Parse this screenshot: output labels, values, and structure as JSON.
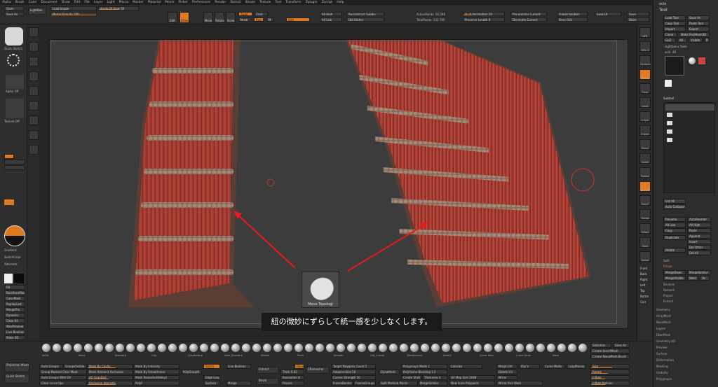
{
  "menu": [
    "Alpha",
    "Brush",
    "Color",
    "Document",
    "Draw",
    "Edit",
    "File",
    "Layer",
    "Light",
    "Macro",
    "Marker",
    "Material",
    "Movie",
    "Picker",
    "Preferences",
    "Render",
    "Stencil",
    "Stroke",
    "Texture",
    "Tool",
    "Transform",
    "Zplugin",
    "Zscript",
    "Help"
  ],
  "top": {
    "open": "Open",
    "save_as": "Save As",
    "lightbox": "LightBox",
    "load_image": "Load Image",
    "model_opacity": "Model Opacity 100",
    "angle_of_view": "Angle Of View 50",
    "edit": "Edit",
    "draw": "Draw",
    "move": "Move",
    "rotate": "Rotate",
    "scale": "Scale",
    "zadd": "Zadd",
    "zsub": "Zsub",
    "mrgb": "Mrgb",
    "rgb": "Rgb",
    "m": "M",
    "size": "Size",
    "all_high": "All High",
    "all_low": "All Low",
    "reconstruct_subdiv": "Reconstruct Subdiv",
    "del_higher": "Del Higher",
    "active_points": "ActivePoints: 56,596",
    "total_points": "TotalPoints: 132.795",
    "pct_decimation": "% of decimation 20",
    "preserve_length": "Preserve Length 0",
    "preprocess": "Pre-process Current",
    "decimate": "Decimate Current",
    "freeze_borders": "Freeze borders",
    "keep_uvs": "Keep UVs",
    "save_ui": "Save UI",
    "save": "Save",
    "store": "Store"
  },
  "left": {
    "quick_sketch": "Quick Sketch",
    "alpha_off": "Alpha Off",
    "texture_off": "Texture Off",
    "gradient": "Gradient",
    "switch_color": "SwitchColor",
    "alternate": "Alternate",
    "fill": "Fill",
    "backface_mask": "BackfaceMask",
    "color_mask": "ColorMask",
    "replay_last": "ReplayLast",
    "merge_tris": "MergeTris",
    "dynamic": "Dynamic",
    "clear_all": "Clear All",
    "wax_preview": "WaxPreview",
    "live_boolean": "Live Boolean",
    "make_3d": "Make 3D",
    "mrgb": "MRGB",
    "rgb": "RGB",
    "m": "M"
  },
  "tools": [
    "Move",
    "Standard",
    "Clay",
    "ClayBuildup",
    "Dam_Standard",
    "Inflat",
    "Pinch",
    "Polish",
    "Smooth"
  ],
  "right_bar": [
    "BPR",
    "SPix 3",
    "Dynamic",
    "Persp",
    "Floor",
    "Local",
    "L.Sym",
    "Frame",
    "Move",
    "Scale",
    "Rotate",
    "Line Fill",
    "PolyF",
    "Transp",
    "Ghost",
    "Solo",
    "Xpose"
  ],
  "right_bar_bottom": [
    "Front",
    "Back",
    "Right",
    "Left",
    "Top",
    "Bottm",
    "Curr"
  ],
  "panel": {
    "title": "Tool",
    "brand": "ochi",
    "load_tool": "Load Tool",
    "save_as": "Save As",
    "copy_tool": "Copy Tool",
    "paste_tool": "Paste Tool",
    "import": "Import",
    "export": "Export",
    "clone": "Clone",
    "make_polymesh": "Make PolyMesh3D",
    "goz": "GoZ",
    "all": "All",
    "visible": "Visible",
    "r": "R",
    "lightbox_tools": "Lightbox ▸ Tools",
    "mesh_label": "ochi. 48",
    "subtool": "Subtool",
    "list_all": "List All",
    "auto_collapse": "Auto Collapse",
    "rename": "Rename",
    "auto_reorder": "AutoReorder",
    "all_low": "All Low",
    "all_high": "All High",
    "copy": "Copy",
    "paste": "Paste",
    "duplicate": "Duplicate",
    "append": "Append",
    "insert": "Insert",
    "delete": "Delete",
    "del_other": "Del Other",
    "del_all": "Del All",
    "split": "Split",
    "merge": "Merge",
    "merge_down": "MergeDown",
    "merge_similar": "MergeSimilar",
    "merge_visible": "MergeVisible",
    "weld": "Weld",
    "uv": "Uv",
    "boolean": "Boolean",
    "remesh": "Remesh",
    "project": "Project",
    "extract": "Extract",
    "sections": [
      "Geometry",
      "ArrayMesh",
      "NanoMesh",
      "Layers",
      "FiberMesh",
      "Geometry HD",
      "Preview",
      "Surface",
      "Deformation",
      "Masking",
      "Visibility",
      "Polygroups"
    ]
  },
  "bottom": {
    "auto_groups": "Auto Groups",
    "group_visible": "GroupsVisible",
    "mask_by_cavity": "Mask By Cavity",
    "mask_by_intensity": "Mask By Intensity",
    "mask_ambient_occlusion": "Mask Ambient Occlusion",
    "mask_by_smoothness": "Mask By Smoothness",
    "group_masked_clear_mask": "Group Masked Clear Mask",
    "auto_groups_with_uv": "Auto Groups With UV",
    "clear_curve_tips": "Clear curve tips",
    "ao_scan_dist": "AO ScanDist",
    "occlusion_intensity": "Occlusion Intensity",
    "mask_peaks_valleys": "Mask PeaksAndValleys",
    "polygon_lines": "PolyGroupIt",
    "polyf": "PolyF",
    "spans": "Spans",
    "edge_loop": "Edge Loop",
    "live_boolean": "Live Boolean",
    "surface": "Surface",
    "merge": "Merge",
    "extract": "Extract",
    "thick": "Thick 0.02",
    "dynamesh": "DynaMesh",
    "resolution": "Resolution 8",
    "bevel": "Bevel",
    "project": "Project",
    "zremesher": "ZRemesher",
    "target_polygons": "Target Polygons Count 5",
    "adaptive_size": "AdaptiveSize 50",
    "curves_strength": "Curves Strength 50",
    "freeze_border": "FreezeBorder",
    "freeze_groups": "FreezeGroups",
    "split_masked": "Split Masked Points",
    "polygroup_mode": "Polygroups Mode 1",
    "polyframe": "Polyframe Blending 1.5",
    "create_shell": "Create Shell",
    "thickness": "Thickness 4",
    "uv_map_size": "UV Map Size 2048",
    "merge_similar": "MergeSimilar",
    "new_from_polypaint": "New From Polypaint",
    "colorize": "Colorize",
    "delete_uv": "Delete UV",
    "mirror": "Mirror",
    "mirror_and_weld": "Mirror And Weld",
    "flip_v": "Flip V",
    "morph_uv": "Morph UV",
    "curve_mode": "Curve Mode",
    "lazymouse": "LazyMouse",
    "selection": "Selection",
    "save_as": "Save As",
    "create_insert_mesh": "Create InsertMesh",
    "create_nanomesh_brush": "Create NanoMesh Brush",
    "size": "Size",
    "rotate": "Rotate",
    "inflate": "Inflate",
    "inflate_balloon": "Inflate Balloon",
    "projection_master": "Projection Master",
    "quick_sketch": "Quick Sketch",
    "brush_labels": [
      "Inflat",
      "Move",
      "Standard",
      "Clay",
      "ClayBuildup",
      "Dam_Standard",
      "hPolish",
      "Pinch",
      "Smooth",
      "Orb_Cracks",
      "TrimDynamic",
      "Slash3",
      "Curve Tube",
      "Curve Strap",
      "Mask"
    ]
  },
  "canvas": {
    "subtitle": "紐の微妙にずらして統一感を少しなくします。",
    "tool_label": "Move Topologi"
  },
  "colors": {
    "accent": "#e07a1f",
    "arrow": "#e81a1a",
    "cloth": "#a8392e",
    "rope": "#6e4a3a"
  }
}
